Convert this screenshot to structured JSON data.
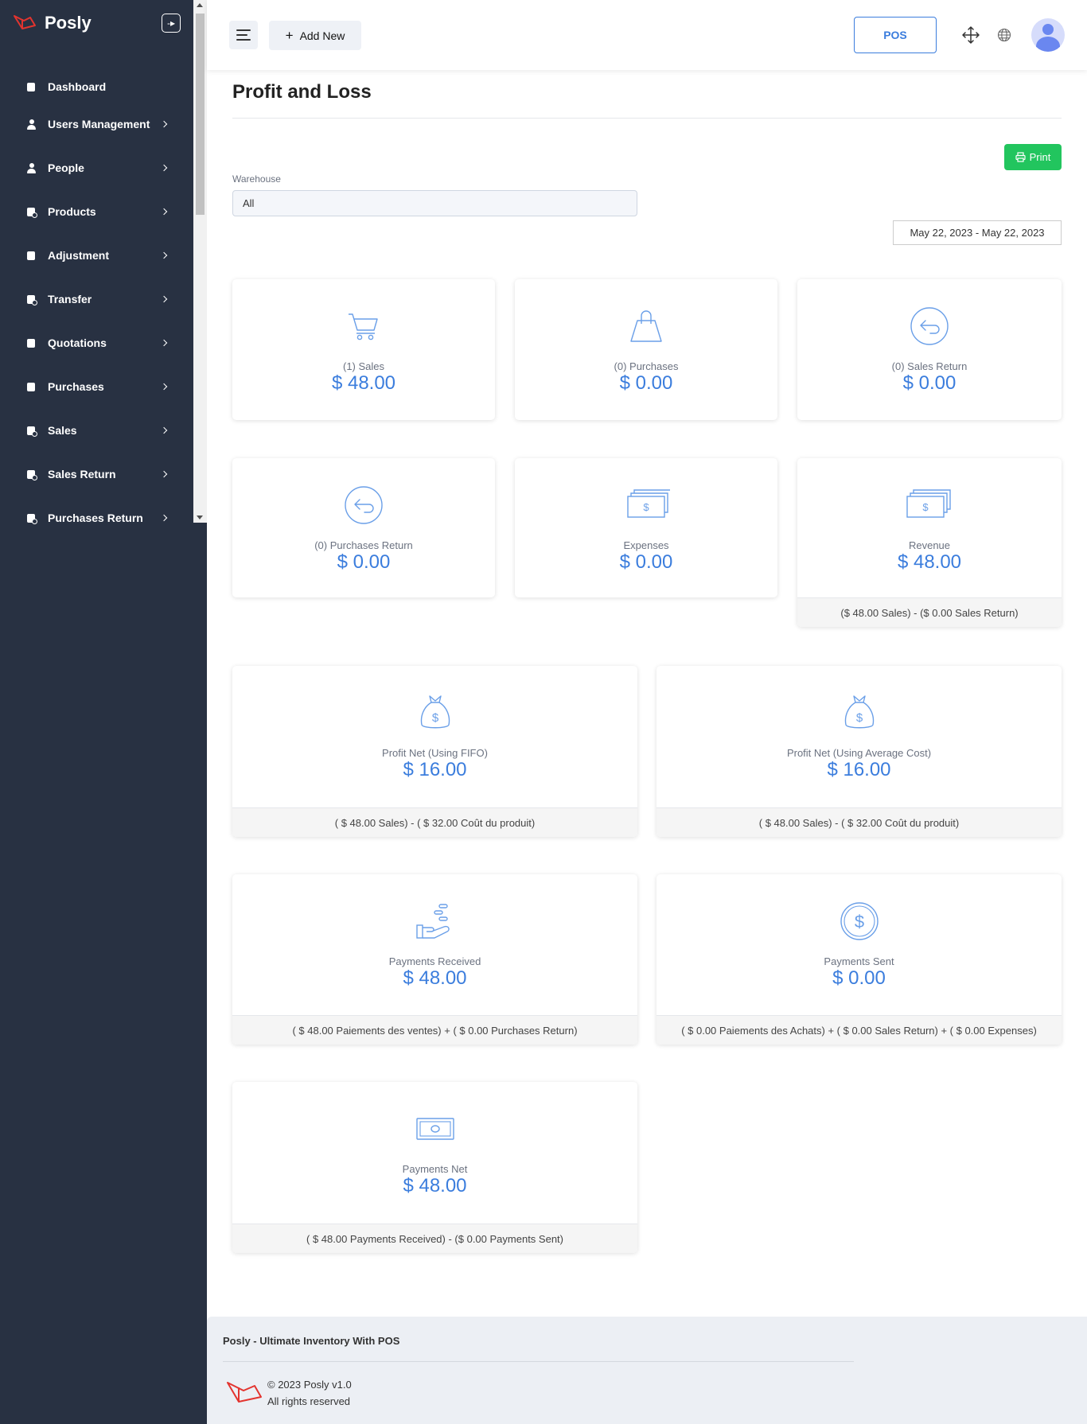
{
  "app": {
    "brand": "Posly"
  },
  "sidebar": {
    "items": [
      {
        "label": "Dashboard",
        "icon": "dashboard-icon"
      },
      {
        "label": "Users Management",
        "icon": "user-icon"
      },
      {
        "label": "People",
        "icon": "people-icon"
      },
      {
        "label": "Products",
        "icon": "products-icon"
      },
      {
        "label": "Adjustment",
        "icon": "adjustment-icon"
      },
      {
        "label": "Transfer",
        "icon": "transfer-icon"
      },
      {
        "label": "Quotations",
        "icon": "quotations-icon"
      },
      {
        "label": "Purchases",
        "icon": "purchases-icon"
      },
      {
        "label": "Sales",
        "icon": "sales-icon"
      },
      {
        "label": "Sales Return",
        "icon": "sales-return-icon"
      },
      {
        "label": "Purchases Return",
        "icon": "purchases-return-icon"
      }
    ]
  },
  "header": {
    "add_new": "Add New",
    "pos": "POS"
  },
  "page": {
    "title": "Profit and Loss",
    "print": "Print",
    "warehouse_label": "Warehouse",
    "warehouse_value": "All",
    "date_range": "May 22, 2023 - May 22, 2023"
  },
  "cards": {
    "sales": {
      "label": "(1) Sales",
      "value": "$ 48.00"
    },
    "purchases": {
      "label": "(0) Purchases",
      "value": "$ 0.00"
    },
    "sales_return": {
      "label": "(0) Sales Return",
      "value": "$ 0.00"
    },
    "purchases_return": {
      "label": "(0) Purchases Return",
      "value": "$ 0.00"
    },
    "expenses": {
      "label": "Expenses",
      "value": "$ 0.00"
    },
    "revenue": {
      "label": "Revenue",
      "value": "$ 48.00",
      "foot": "($ 48.00 Sales) - ($ 0.00 Sales Return)"
    },
    "profit_fifo": {
      "label": "Profit Net (Using FIFO)",
      "value": "$ 16.00",
      "foot": "( $ 48.00 Sales) - ( $ 32.00 Coût du produit)"
    },
    "profit_avg": {
      "label": "Profit Net (Using Average Cost)",
      "value": "$ 16.00",
      "foot": "( $ 48.00 Sales) - ( $ 32.00 Coût du produit)"
    },
    "payments_received": {
      "label": "Payments Received",
      "value": "$ 48.00",
      "foot": "( $ 48.00 Paiements des ventes) + ( $ 0.00 Purchases Return)"
    },
    "payments_sent": {
      "label": "Payments Sent",
      "value": "$ 0.00",
      "foot": "( $ 0.00 Paiements des Achats) + ( $ 0.00 Sales Return) + ( $ 0.00 Expenses)"
    },
    "payments_net": {
      "label": "Payments Net",
      "value": "$ 48.00",
      "foot": "( $ 48.00 Payments Received) - ($ 0.00 Payments Sent)"
    }
  },
  "footer": {
    "title": "Posly - Ultimate Inventory With POS",
    "copyright": "© 2023 Posly v1.0",
    "rights": "All rights reserved"
  },
  "colors": {
    "sidebar": "#283142",
    "accent": "#3b7ddd",
    "print": "#22c55e",
    "logo": "#e3342f"
  }
}
